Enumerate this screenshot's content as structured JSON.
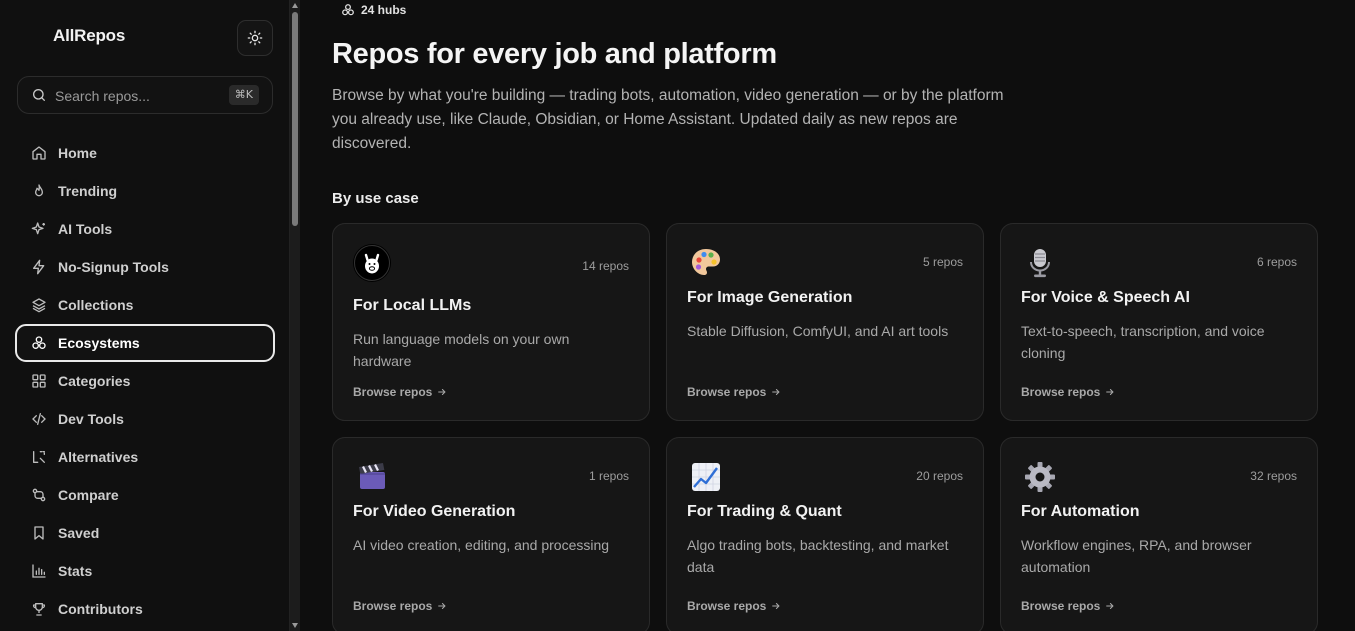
{
  "sidebar": {
    "brand": "AllRepos",
    "search": {
      "placeholder": "Search repos...",
      "shortcut": "⌘K"
    },
    "items": [
      {
        "label": "Home",
        "icon": "home-icon"
      },
      {
        "label": "Trending",
        "icon": "flame-icon"
      },
      {
        "label": "AI Tools",
        "icon": "sparkles-icon"
      },
      {
        "label": "No-Signup Tools",
        "icon": "zap-icon"
      },
      {
        "label": "Collections",
        "icon": "layers-icon"
      },
      {
        "label": "Ecosystems",
        "icon": "ecosystem-icon",
        "active": true
      },
      {
        "label": "Categories",
        "icon": "grid-icon"
      },
      {
        "label": "Dev Tools",
        "icon": "code-icon"
      },
      {
        "label": "Alternatives",
        "icon": "swap-icon"
      },
      {
        "label": "Compare",
        "icon": "compare-icon"
      },
      {
        "label": "Saved",
        "icon": "bookmark-icon"
      },
      {
        "label": "Stats",
        "icon": "bar-chart-icon"
      },
      {
        "label": "Contributors",
        "icon": "trophy-icon"
      }
    ]
  },
  "main": {
    "hubs_label": "24 hubs",
    "title": "Repos for every job and platform",
    "description": "Browse by what you're building — trading bots, automation, video generation — or by the platform you already use, like Claude, Obsidian, or Home Assistant. Updated daily as new repos are discovered.",
    "section_title": "By use case",
    "cards": [
      {
        "icon": "llama-icon",
        "count": "14 repos",
        "title": "For Local LLMs",
        "description": "Run language models on your own hardware",
        "link": "Browse repos"
      },
      {
        "icon": "palette-icon",
        "count": "5 repos",
        "title": "For Image Generation",
        "description": "Stable Diffusion, ComfyUI, and AI art tools",
        "link": "Browse repos"
      },
      {
        "icon": "microphone-icon",
        "count": "6 repos",
        "title": "For Voice & Speech AI",
        "description": "Text-to-speech, transcription, and voice cloning",
        "link": "Browse repos"
      },
      {
        "icon": "clapper-icon",
        "count": "1 repos",
        "title": "For Video Generation",
        "description": "AI video creation, editing, and processing",
        "link": "Browse repos"
      },
      {
        "icon": "chart-increasing-icon",
        "count": "20 repos",
        "title": "For Trading & Quant",
        "description": "Algo trading bots, backtesting, and market data",
        "link": "Browse repos"
      },
      {
        "icon": "gear-icon",
        "count": "32 repos",
        "title": "For Automation",
        "description": "Workflow engines, RPA, and browser automation",
        "link": "Browse repos"
      }
    ]
  }
}
